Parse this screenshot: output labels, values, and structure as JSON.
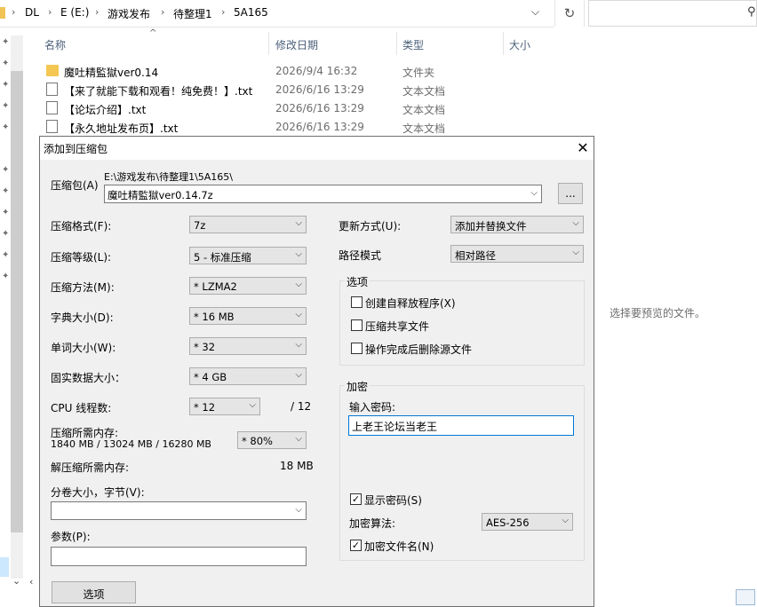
{
  "explorer": {
    "breadcrumb": [
      "DL",
      "E (E:)",
      "游戏发布",
      "待整理1",
      "5A165"
    ],
    "columns": {
      "name": "名称",
      "date": "修改日期",
      "type": "类型",
      "size": "大小"
    },
    "files": [
      {
        "name": "魔吐精監獄ver0.14",
        "date": "2026/9/4 16:32",
        "type": "文件夹",
        "icon": "folder-icon"
      },
      {
        "name": "【来了就能下载和观看！纯免费！】.txt",
        "date": "2026/6/16 13:29",
        "type": "文本文档",
        "icon": "text-file-icon"
      },
      {
        "name": "【论坛介绍】.txt",
        "date": "2026/6/16 13:29",
        "type": "文本文档",
        "icon": "text-file-icon"
      },
      {
        "name": "【永久地址发布页】.txt",
        "date": "2026/6/16 13:29",
        "type": "文本文档",
        "icon": "text-file-icon"
      }
    ],
    "preview_text": "选择要预览的文件。"
  },
  "dialog": {
    "title": "添加到压缩包",
    "archive_label": "压缩包(A)",
    "archive_path": "E:\\游戏发布\\待整理1\\5A165\\",
    "archive_name": "魔吐精監獄ver0.14.7z",
    "browse_label": "...",
    "format_label": "压缩格式(F):",
    "format_value": "7z",
    "level_label": "压缩等级(L):",
    "level_value": "5 - 标准压缩",
    "method_label": "压缩方法(M):",
    "method_value": "* LZMA2",
    "dict_label": "字典大小(D):",
    "dict_value": "* 16 MB",
    "word_label": "单词大小(W):",
    "word_value": "* 32",
    "solid_label": "固实数据大小：",
    "solid_value": "* 4 GB",
    "cpu_label": "CPU 线程数:",
    "cpu_value": "* 12",
    "cpu_total": "/ 12",
    "mem_label": "压缩所需内存:",
    "mem_detail": "1840 MB / 13024 MB / 16280 MB",
    "mem_percent": "* 80%",
    "decomp_label": "解压缩所需内存:",
    "decomp_value": "18 MB",
    "split_label": "分卷大小，字节(V):",
    "split_value": "",
    "params_label": "参数(P):",
    "params_value": "",
    "options_button": "选项",
    "update_label": "更新方式(U):",
    "update_value": "添加并替换文件",
    "path_label": "路径模式",
    "path_value": "相对路径",
    "options_group": "选项",
    "opt_sfx": "创建自释放程序(X)",
    "opt_shared": "压缩共享文件",
    "opt_delete": "操作完成后删除源文件",
    "encryption_group": "加密",
    "password_label": "输入密码:",
    "password_value": "上老王论坛当老王",
    "show_password": "显示密码(S)",
    "algo_label": "加密算法:",
    "algo_value": "AES-256",
    "encrypt_names": "加密文件名(N)"
  }
}
